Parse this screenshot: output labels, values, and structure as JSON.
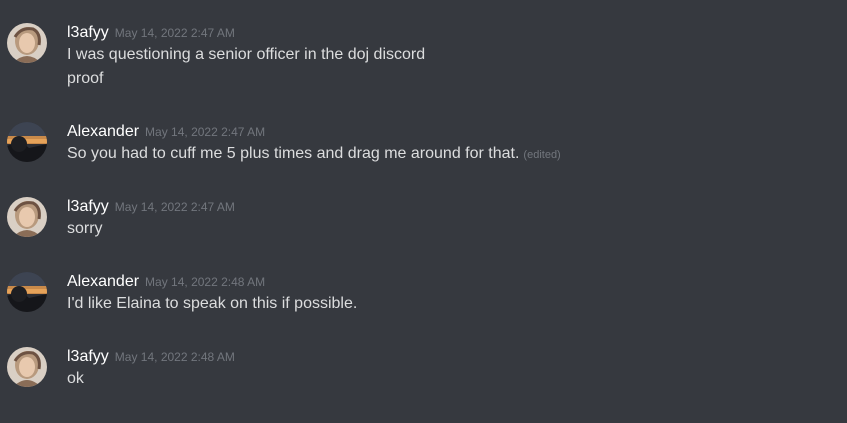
{
  "messages": [
    {
      "author": "l3afyy",
      "avatar_icon": "l3afyy-avatar-icon",
      "timestamp": "May 14, 2022 2:47 AM",
      "lines": [
        "I was questioning a senior officer in the doj discord",
        "proof"
      ]
    },
    {
      "author": "Alexander",
      "avatar_icon": "alexander-avatar-icon",
      "timestamp": "May 14, 2022 2:47 AM",
      "lines": [
        "So you had to cuff me 5 plus times and drag me around for that."
      ],
      "edited_label": "(edited)"
    },
    {
      "author": "l3afyy",
      "avatar_icon": "l3afyy-avatar-icon",
      "timestamp": "May 14, 2022 2:47 AM",
      "lines": [
        "sorry"
      ]
    },
    {
      "author": "Alexander",
      "avatar_icon": "alexander-avatar-icon",
      "timestamp": "May 14, 2022 2:48 AM",
      "lines": [
        "I'd like Elaina to speak on this if possible."
      ]
    },
    {
      "author": "l3afyy",
      "avatar_icon": "l3afyy-avatar-icon",
      "timestamp": "May 14, 2022 2:48 AM",
      "lines": [
        "ok"
      ]
    }
  ],
  "colors": {
    "background": "#36393f",
    "username": "#ffffff",
    "message_text": "#dcddde",
    "timestamp": "#72767d"
  }
}
